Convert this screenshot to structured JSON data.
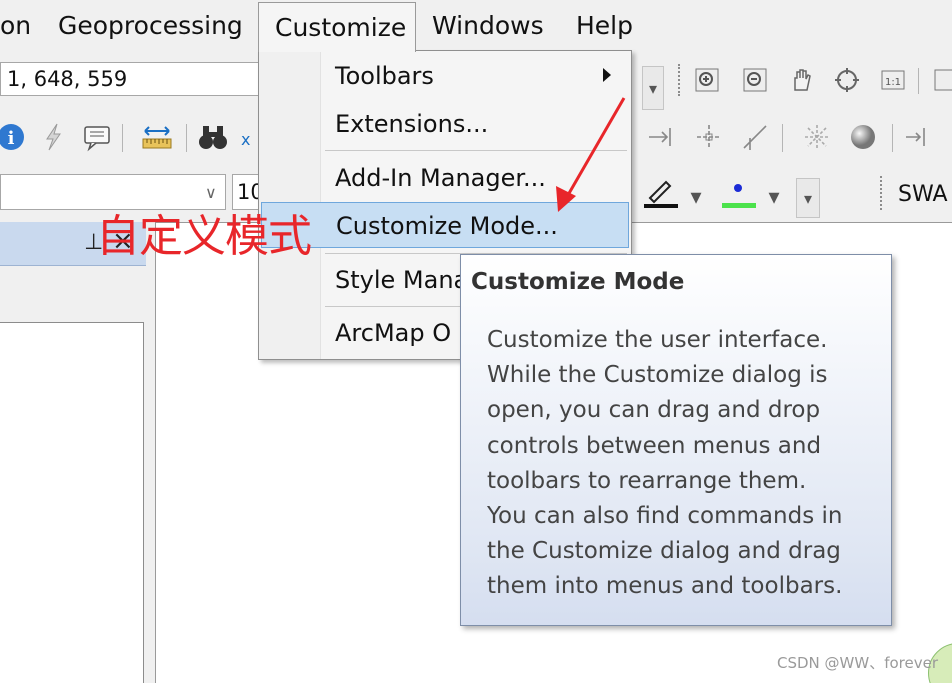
{
  "menubar": {
    "items": [
      "on",
      "Geoprocessing",
      "Customize",
      "Windows",
      "Help"
    ]
  },
  "toolbar": {
    "scale_value": "1, 648, 559",
    "small_combo_value": "10",
    "swa_label": "SWA"
  },
  "customize_menu": {
    "items": [
      {
        "label": "Toolbars"
      },
      {
        "label": "Extensions..."
      },
      {
        "label": "Add-In Manager..."
      },
      {
        "label": "Customize Mode..."
      },
      {
        "label": "Style Mana"
      },
      {
        "label": "ArcMap O"
      }
    ]
  },
  "tooltip": {
    "title": "Customize Mode",
    "lines": [
      "Customize the user interface.",
      "While the Customize dialog is",
      "open, you can drag and drop",
      "controls between menus and",
      "toolbars to rearrange them.",
      "You can also find commands in",
      "the Customize dialog and drag",
      "them into menus and toolbars."
    ]
  },
  "annotation": {
    "text": "自定义模式",
    "color": "#e8262a"
  },
  "panel": {
    "pin_glyph": "⊥",
    "close_glyph": "×"
  },
  "watermark": "CSDN @WW、forever",
  "colors": {
    "highlight": "#c7def3",
    "highlight_border": "#6fa7dc",
    "annotation_red": "#e8262a"
  }
}
